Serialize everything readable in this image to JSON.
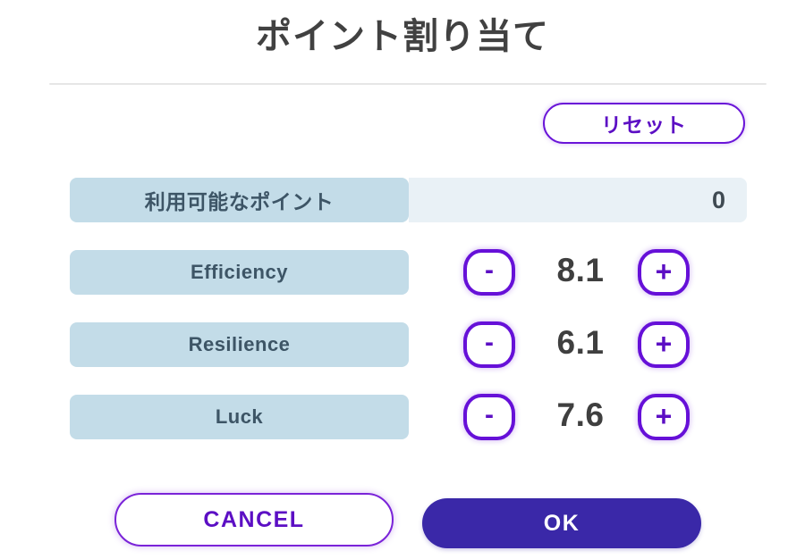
{
  "dialog": {
    "title": "ポイント割り当て"
  },
  "reset": {
    "label": "リセット"
  },
  "available": {
    "label": "利用可能なポイント",
    "value": "0"
  },
  "stepper_glyphs": {
    "minus": "-",
    "plus": "+"
  },
  "stats": [
    {
      "label": "Efficiency",
      "value": "8.1"
    },
    {
      "label": "Resilience",
      "value": "6.1"
    },
    {
      "label": "Luck",
      "value": "7.6"
    }
  ],
  "footer": {
    "cancel_label": "CANCEL",
    "ok_label": "OK"
  },
  "colors": {
    "accent_purple": "#6610d8",
    "accent_purple_text": "#5c0fc4",
    "ok_fill": "#3a28a8",
    "chip_blue": "#c3dce8",
    "value_strip_blue": "#e9f1f6",
    "label_text": "#3d5566",
    "value_text": "#3f3f3f",
    "title_text": "#414141",
    "divider": "#e6e6e6"
  }
}
